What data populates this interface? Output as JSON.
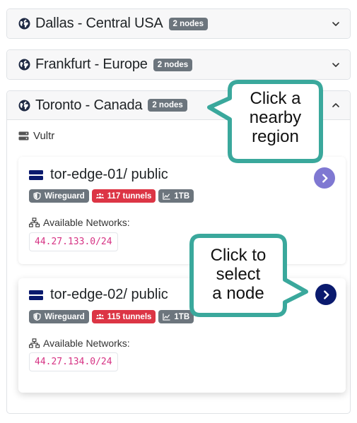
{
  "regions": [
    {
      "name": "Dallas - Central USA",
      "badge": "2 nodes",
      "expanded": false
    },
    {
      "name": "Frankfurt - Europe",
      "badge": "2 nodes",
      "expanded": false
    },
    {
      "name": "Toronto - Canada",
      "badge": "2 nodes",
      "expanded": true
    }
  ],
  "provider": "Vultr",
  "nodes": [
    {
      "name": "tor-edge-01",
      "scope": " / public",
      "protocol": "Wireguard",
      "tunnels": "117 tunnels",
      "bandwidth": "1TB",
      "networks_label": "Available Networks:",
      "network": "44.27.133.0/24"
    },
    {
      "name": "tor-edge-02",
      "scope": " / public",
      "protocol": "Wireguard",
      "tunnels": "115 tunnels",
      "bandwidth": "1TB",
      "networks_label": "Available Networks:",
      "network": "44.27.134.0/24"
    }
  ],
  "callouts": {
    "region": [
      "Click a",
      "nearby",
      "region"
    ],
    "node": [
      "Click to",
      "select",
      "a node"
    ]
  },
  "colors": {
    "badge": "#6c757d",
    "tunnels": "#dc3545",
    "cidr_text": "#d63384",
    "select_light": "#7f78d2",
    "select_dark": "#0a1a6e",
    "callout_border": "#3aa89c",
    "server_icon": "#0a1a6e"
  },
  "icons": {
    "region": "globe-icon",
    "chevron_down": "chevron-down-icon",
    "chevron_up": "chevron-up-icon",
    "provider": "server-icon",
    "protocol": "shield-icon",
    "tunnels": "users-icon",
    "bandwidth": "chart-line-icon",
    "networks": "network-icon",
    "select": "chevron-right-icon"
  }
}
